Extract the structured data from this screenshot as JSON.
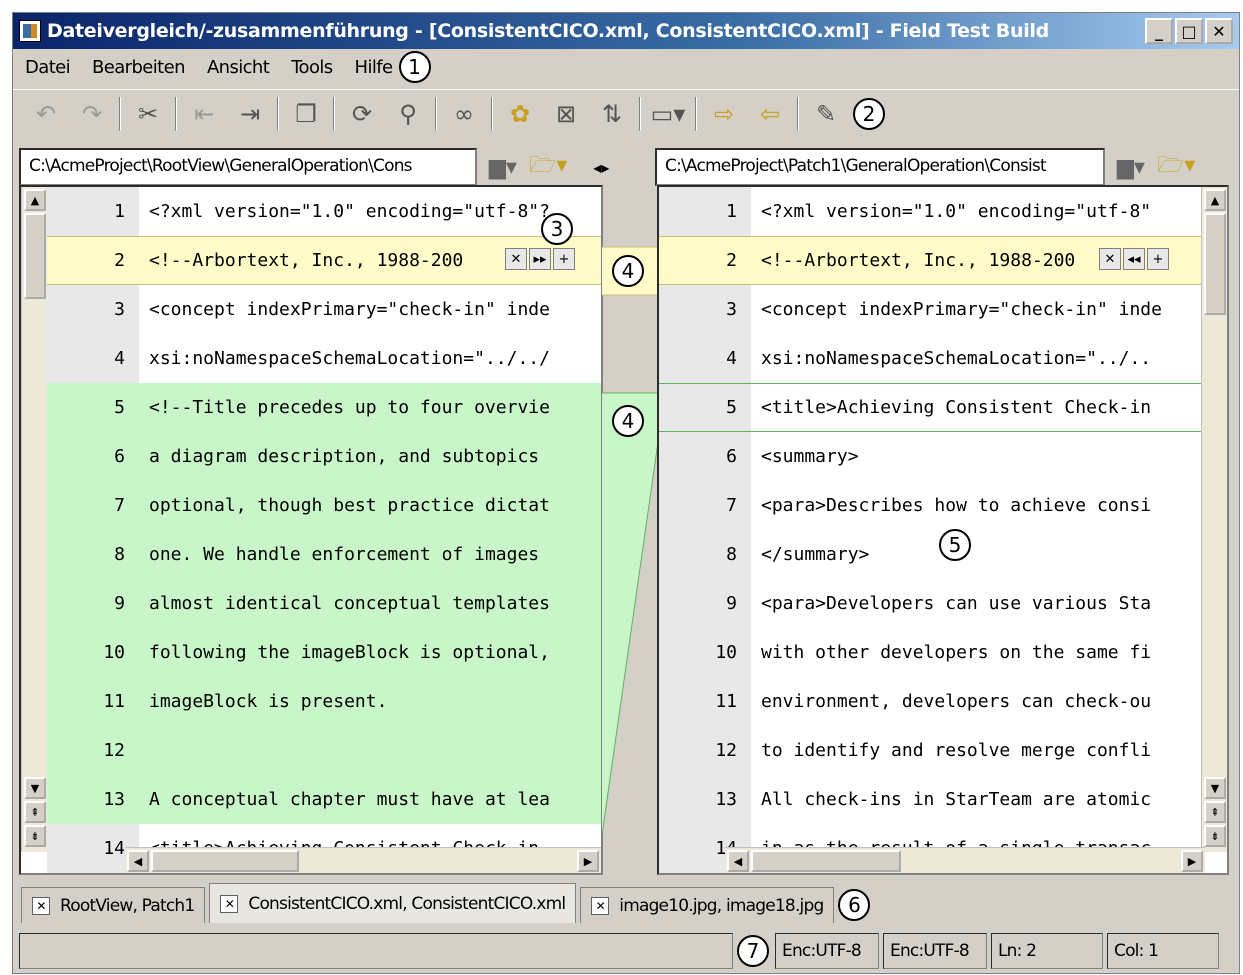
{
  "window": {
    "title": "Dateivergleich/-zusammenführung - [ConsistentCICO.xml, ConsistentCICO.xml] - Field Test Build",
    "controls": [
      "_",
      "□",
      "✕"
    ]
  },
  "menu": {
    "items": [
      "Datei",
      "Bearbeiten",
      "Ansicht",
      "Tools",
      "Hilfe"
    ]
  },
  "callouts": {
    "c1": "1",
    "c2": "2",
    "c3": "3",
    "c4": "4",
    "c4b": "4",
    "c5": "5",
    "c6": "6",
    "c7": "7"
  },
  "paths": {
    "left": "C:\\AcmeProject\\RootView\\GeneralOperation\\Cons",
    "right": "C:\\AcmeProject\\Patch1\\GeneralOperation\\Consist"
  },
  "left_lines": [
    {
      "n": "1",
      "t": "<?xml version=\"1.0\" encoding=\"utf-8\"?"
    },
    {
      "n": "2",
      "t": "<!--Arbortext, Inc., 1988-200"
    },
    {
      "n": "3",
      "t": "<concept indexPrimary=\"check-in\" inde"
    },
    {
      "n": "4",
      "t": "xsi:noNamespaceSchemaLocation=\"../../"
    },
    {
      "n": "5",
      "t": "<!--Title precedes up to four overvie"
    },
    {
      "n": "6",
      "t": "a diagram description, and subtopics"
    },
    {
      "n": "7",
      "t": "optional, though best practice dictat"
    },
    {
      "n": "8",
      "t": "one. We handle enforcement of images"
    },
    {
      "n": "9",
      "t": "almost identical conceptual templates"
    },
    {
      "n": "10",
      "t": "following the imageBlock is optional,"
    },
    {
      "n": "11",
      "t": "imageBlock is present."
    },
    {
      "n": "12",
      "t": ""
    },
    {
      "n": "13",
      "t": "A conceptual chapter must have at lea"
    },
    {
      "n": "14",
      "t": "<title>Achieving Consistent Check-in"
    }
  ],
  "right_lines": [
    {
      "n": "1",
      "t": "<?xml version=\"1.0\" encoding=\"utf-8\""
    },
    {
      "n": "2",
      "t": "<!--Arbortext, Inc., 1988-200"
    },
    {
      "n": "3",
      "t": "<concept indexPrimary=\"check-in\" inde"
    },
    {
      "n": "4",
      "t": "xsi:noNamespaceSchemaLocation=\"../.."
    },
    {
      "n": "5",
      "t": "<title>Achieving Consistent Check-in"
    },
    {
      "n": "6",
      "t": "<summary>"
    },
    {
      "n": "7",
      "t": "<para>Describes how to achieve consi"
    },
    {
      "n": "8",
      "t": "</summary>"
    },
    {
      "n": "9",
      "t": "<para>Developers can use various Sta"
    },
    {
      "n": "10",
      "t": "with other developers on the same fi"
    },
    {
      "n": "11",
      "t": "environment, developers can check-ou"
    },
    {
      "n": "12",
      "t": "to identify and resolve merge confli"
    },
    {
      "n": "13",
      "t": "All check-ins in StarTeam are atomic"
    },
    {
      "n": "14",
      "t": "in as the result of a single transac"
    }
  ],
  "tabs": [
    {
      "label": "RootView, Patch1"
    },
    {
      "label": "ConsistentCICO.xml, ConsistentCICO.xml"
    },
    {
      "label": "image10.jpg, image18.jpg"
    }
  ],
  "status": {
    "enc_left": "Enc:UTF-8",
    "enc_right": "Enc:UTF-8",
    "line": "Ln: 2",
    "col": "Col: 1"
  },
  "colors": {
    "changed": "#fffbc8",
    "inserted": "#c8f6c8",
    "titlebar": "#0a246a"
  },
  "icons": {
    "toolbar": [
      "undo-icon",
      "redo-icon",
      "find-icon",
      "prev-diff-icon",
      "next-diff-icon",
      "copy-icon",
      "refresh-icon",
      "merge-icon",
      "link-icon",
      "ignore-icon",
      "ignore-case-icon",
      "sync-icon",
      "view-mode-icon",
      "copy-left-icon",
      "copy-right-icon",
      "tools-icon"
    ]
  }
}
